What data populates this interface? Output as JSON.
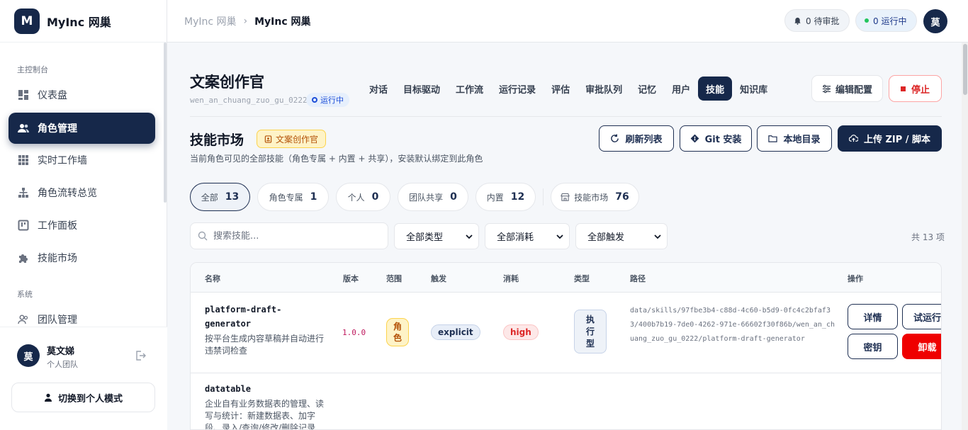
{
  "brand": {
    "logo": "M",
    "name": "MyInc 网巢"
  },
  "sidebar": {
    "section_main": "主控制台",
    "items": [
      {
        "label": "仪表盘",
        "icon": "dashboard-icon"
      },
      {
        "label": "角色管理",
        "icon": "users-icon",
        "active": true
      },
      {
        "label": "实时工作墙",
        "icon": "grid-icon"
      },
      {
        "label": "角色流转总览",
        "icon": "flow-icon"
      },
      {
        "label": "工作面板",
        "icon": "board-icon"
      },
      {
        "label": "技能市场",
        "icon": "puzzle-icon"
      }
    ],
    "section_system": "系统",
    "system_items": [
      {
        "label": "团队管理",
        "icon": "team-icon"
      }
    ]
  },
  "user": {
    "avatar": "莫",
    "name": "莫文娣",
    "team": "个人团队",
    "switch_label": "切换到个人模式"
  },
  "header": {
    "breadcrumb": [
      "MyInc 网巢",
      "MyInc 网巢"
    ],
    "pending_label": "0 待审批",
    "running_label": "0 运行中",
    "avatar": "莫"
  },
  "agent": {
    "title": "文案创作官",
    "id": "wen_an_chuang_zuo_gu_0222",
    "status": "运行中",
    "tabs": [
      "对话",
      "目标驱动",
      "工作流",
      "运行记录",
      "评估",
      "审批队列",
      "记忆",
      "用户",
      "技能",
      "知识库"
    ],
    "active_tab": "技能",
    "config_label": "编辑配置",
    "stop_label": "停止"
  },
  "skills": {
    "title": "技能市场",
    "role_tag": "文案创作官",
    "description": "当前角色可见的全部技能（角色专属 + 内置 + 共享），安装默认绑定到此角色",
    "actions": {
      "refresh": "刷新列表",
      "git": "Git 安装",
      "local": "本地目录",
      "upload": "上传 ZIP / 脚本"
    },
    "filters": [
      {
        "label": "全部",
        "count": "13",
        "active": true
      },
      {
        "label": "角色专属",
        "count": "1"
      },
      {
        "label": "个人",
        "count": "0"
      },
      {
        "label": "团队共享",
        "count": "0"
      },
      {
        "label": "内置",
        "count": "12"
      },
      {
        "label": "技能市场",
        "count": "76"
      }
    ],
    "search_placeholder": "搜索技能...",
    "selects": [
      "全部类型",
      "全部消耗",
      "全部触发"
    ],
    "total": "共 13 项",
    "columns": [
      "名称",
      "版本",
      "范围",
      "触发",
      "消耗",
      "类型",
      "路径",
      "操作"
    ],
    "rows": [
      {
        "name": "platform-draft-generator",
        "description": "按平台生成内容草稿并自动进行违禁词检查",
        "version": "1.0.0",
        "scope": "角色",
        "trigger": "explicit",
        "cost": "high",
        "type": "执行型",
        "path": "data/skills/97fbe3b4-c88d-4c60-b5d9-0fc4c2bfaf33/400b7b19-7de0-4262-971e-66602f30f86b/wen_an_chuang_zuo_gu_0222/platform-draft-generator",
        "ops": {
          "detail": "详情",
          "try": "试运行",
          "key": "密钥",
          "uninstall": "卸载"
        }
      },
      {
        "name": "datatable",
        "description": "企业自有业务数据表的管理、读写与统计：新建数据表、加字段、录入/查询/修改/删除记录"
      }
    ]
  }
}
